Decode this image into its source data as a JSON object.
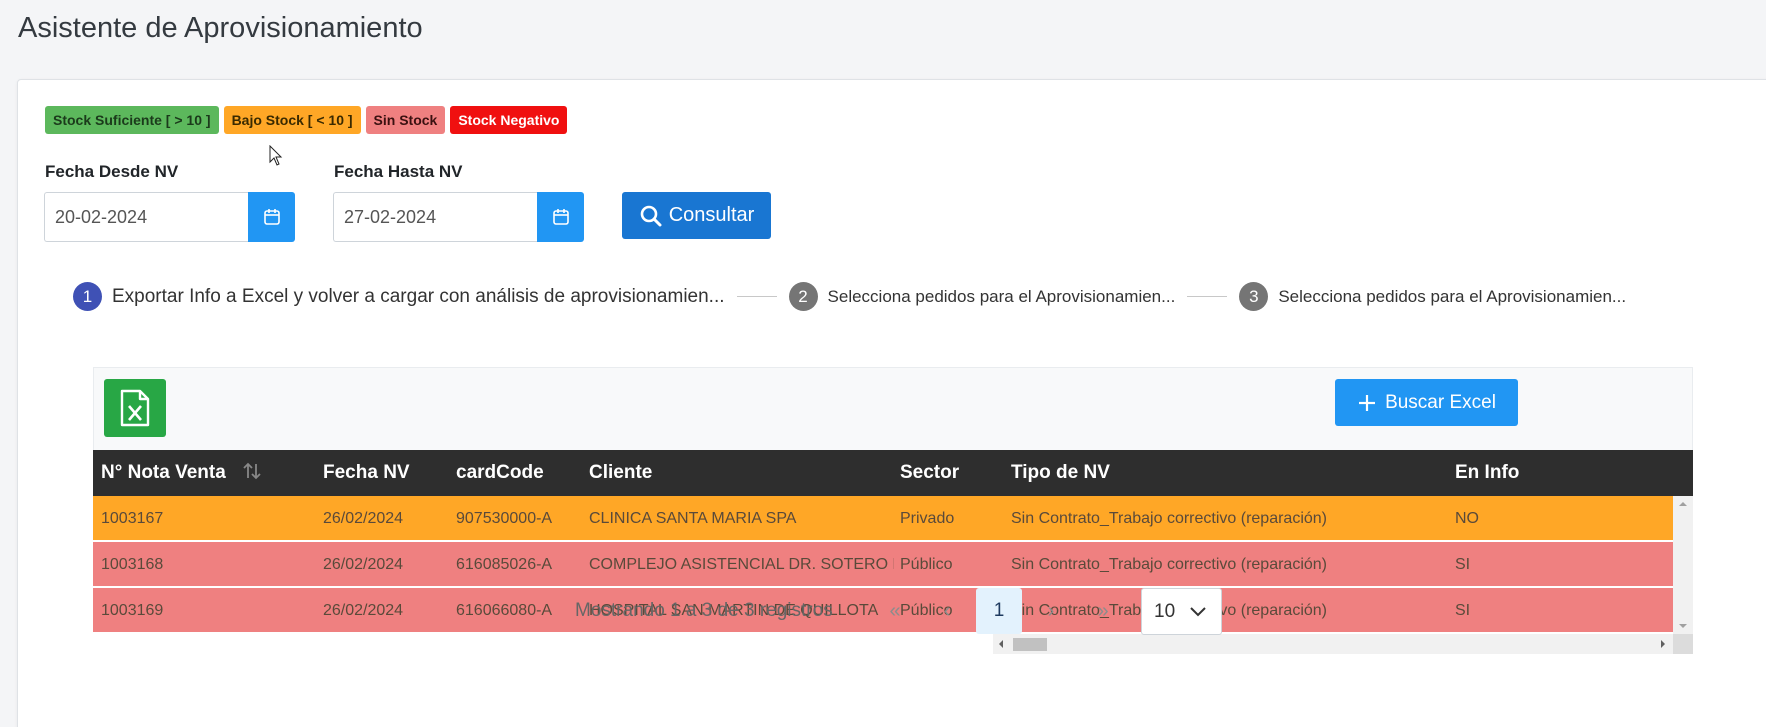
{
  "page": {
    "title": "Asistente de Aprovisionamiento"
  },
  "legend": [
    {
      "label": "Stock Suficiente [ > 10 ]",
      "bg": "#5cb85c",
      "color": "#1b3a1b"
    },
    {
      "label": "Bajo Stock [ < 10 ]",
      "bg": "#ffa726",
      "color": "#3a2a00"
    },
    {
      "label": "Sin Stock",
      "bg": "#ef8080",
      "color": "#3a1010"
    },
    {
      "label": "Stock Negativo",
      "bg": "#f01010",
      "color": "#ffffff"
    }
  ],
  "filters": {
    "from_label": "Fecha Desde NV",
    "from_value": "20-02-2024",
    "to_label": "Fecha Hasta NV",
    "to_value": "27-02-2024",
    "consult_label": "Consultar"
  },
  "steps": [
    {
      "num": "1",
      "label": "Exportar Info a Excel y volver a cargar con análisis de aprovisionamien...",
      "active": true
    },
    {
      "num": "2",
      "label": "Selecciona pedidos para el Aprovisionamien...",
      "active": false
    },
    {
      "num": "3",
      "label": "Selecciona pedidos para el Aprovisionamien...",
      "active": false
    }
  ],
  "toolbar": {
    "buscar_label": "Buscar Excel"
  },
  "table": {
    "columns": [
      "N° Nota Venta",
      "Fecha NV",
      "cardCode",
      "Cliente",
      "Sector",
      "Tipo de NV",
      "En Info"
    ],
    "rows": [
      {
        "nv": "1003167",
        "fecha": "26/02/2024",
        "card": "907530000-A",
        "cliente": "CLINICA SANTA MARIA SPA",
        "sector": "Privado",
        "tipo": "Sin Contrato_Trabajo correctivo (reparación)",
        "info": "NO",
        "status": "orange"
      },
      {
        "nv": "1003168",
        "fecha": "26/02/2024",
        "card": "616085026-A",
        "cliente": "COMPLEJO ASISTENCIAL DR. SOTERO DEL RIO",
        "sector": "Público",
        "tipo": "Sin Contrato_Trabajo correctivo (reparación)",
        "info": "SI",
        "status": "red"
      },
      {
        "nv": "1003169",
        "fecha": "26/02/2024",
        "card": "616066080-A",
        "cliente": "HOSPITAL SAN MARTIN DE QUILLOTA",
        "sector": "Público",
        "tipo": "Sin Contrato_Trabajo correctivo (reparación)",
        "info": "SI",
        "status": "red"
      }
    ]
  },
  "pager": {
    "info": "Mostrando 1 a 3 de 3 registros",
    "first": "«",
    "prev": "‹",
    "current": "1",
    "next": "›",
    "last": "»",
    "page_size": "10"
  }
}
